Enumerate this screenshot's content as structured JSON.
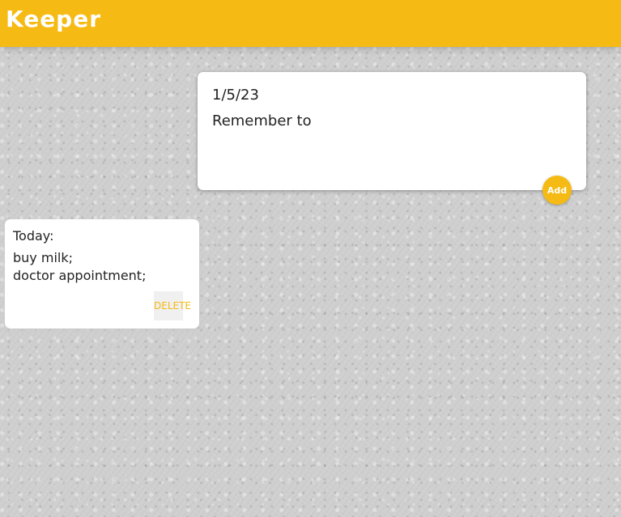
{
  "header": {
    "title": "Keeper"
  },
  "create_note": {
    "title_value": "1/5/23",
    "content_value": "Remember to",
    "add_label": "Add"
  },
  "notes": [
    {
      "title": "Today:",
      "content": "buy milk;\ndoctor appointment;",
      "delete_label": "DELETE"
    }
  ],
  "colors": {
    "accent": "#f5ba13",
    "card": "#ffffff",
    "text": "#222222"
  }
}
